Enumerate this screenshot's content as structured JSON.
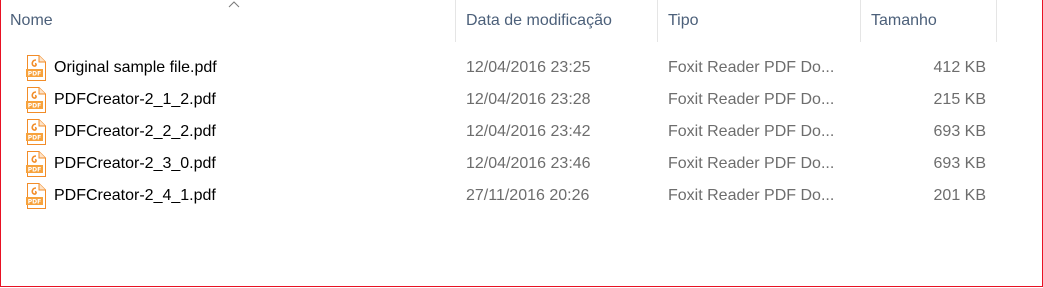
{
  "columns": {
    "name": "Nome",
    "date": "Data de modificação",
    "type": "Tipo",
    "size": "Tamanho"
  },
  "sort": {
    "column": "name",
    "direction": "ascending",
    "icon": "sort-up-arrow-icon"
  },
  "files": [
    {
      "name": "Original sample file.pdf",
      "date": "12/04/2016 23:25",
      "type": "Foxit Reader PDF Do...",
      "size": "412 KB",
      "icon": "pdf-file-icon"
    },
    {
      "name": "PDFCreator-2_1_2.pdf",
      "date": "12/04/2016 23:28",
      "type": "Foxit Reader PDF Do...",
      "size": "215 KB",
      "icon": "pdf-file-icon"
    },
    {
      "name": "PDFCreator-2_2_2.pdf",
      "date": "12/04/2016 23:42",
      "type": "Foxit Reader PDF Do...",
      "size": "693 KB",
      "icon": "pdf-file-icon"
    },
    {
      "name": "PDFCreator-2_3_0.pdf",
      "date": "12/04/2016 23:46",
      "type": "Foxit Reader PDF Do...",
      "size": "693 KB",
      "icon": "pdf-file-icon"
    },
    {
      "name": "PDFCreator-2_4_1.pdf",
      "date": "27/11/2016 20:26",
      "type": "Foxit Reader PDF Do...",
      "size": "201 KB",
      "icon": "pdf-file-icon"
    }
  ],
  "colors": {
    "header_text": "#4c607a",
    "secondary_text": "#6d6d6d",
    "pdf_icon_accent": "#f28c28",
    "window_border": "#e81123"
  }
}
